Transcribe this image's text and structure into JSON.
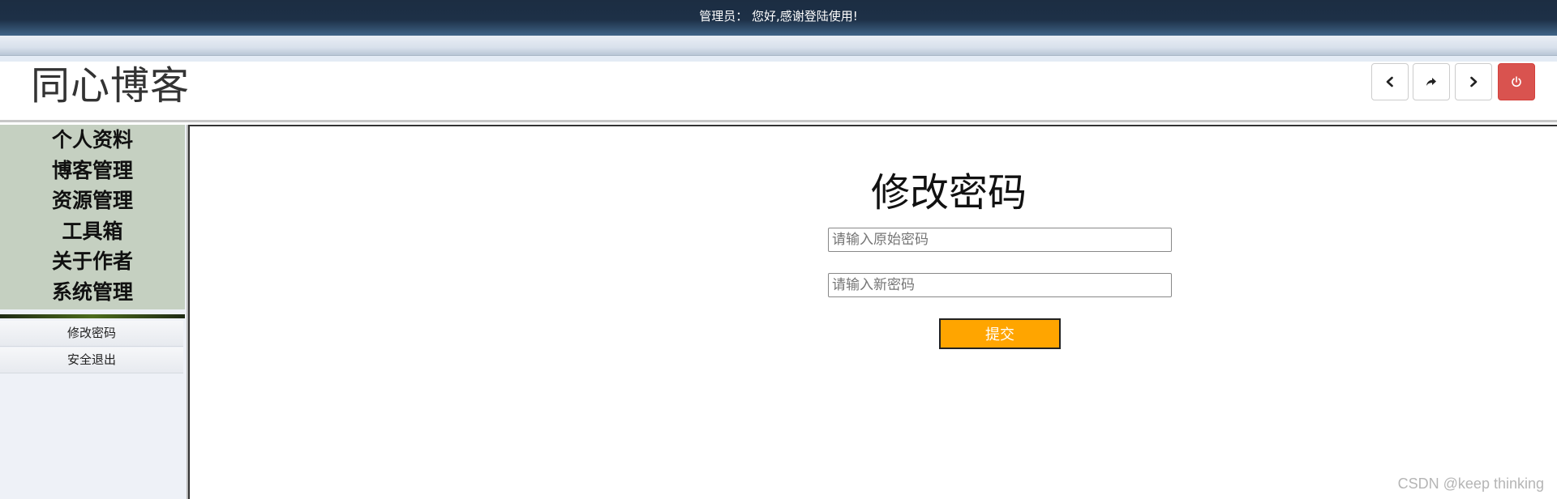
{
  "topbar": {
    "greeting": "管理员： 您好,感谢登陆使用!"
  },
  "header": {
    "brand": "同心博客",
    "buttons": [
      {
        "icon": "chevron-left-icon"
      },
      {
        "icon": "share-arrow-icon"
      },
      {
        "icon": "chevron-right-icon"
      },
      {
        "icon": "power-icon",
        "color": "#d9534f"
      }
    ]
  },
  "sidebar": {
    "nav": [
      {
        "label": "个人资料"
      },
      {
        "label": "博客管理"
      },
      {
        "label": "资源管理"
      },
      {
        "label": "工具箱"
      },
      {
        "label": "关于作者"
      },
      {
        "label": "系统管理"
      }
    ],
    "submenu": [
      {
        "label": "修改密码"
      },
      {
        "label": "安全退出"
      }
    ]
  },
  "form": {
    "title": "修改密码",
    "old_password": {
      "placeholder": "请输入原始密码",
      "value": ""
    },
    "new_password": {
      "placeholder": "请输入新密码",
      "value": ""
    },
    "submit_label": "提交",
    "submit_color": "#ffa500"
  },
  "watermark": "CSDN @keep   thinking"
}
